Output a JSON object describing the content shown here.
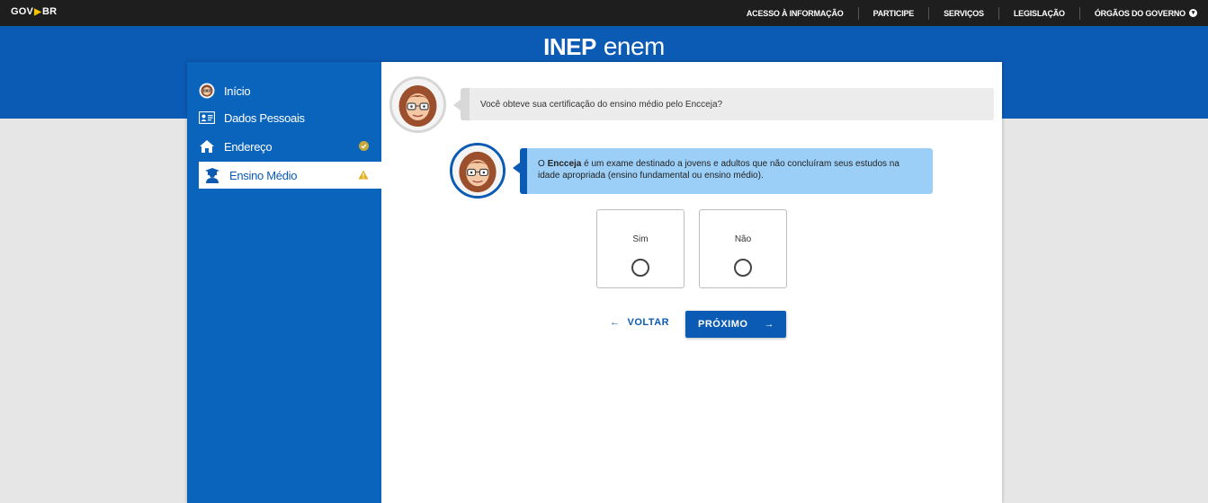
{
  "govbar": {
    "logo_gov": "GOV",
    "logo_br": "BR",
    "nav": [
      "ACESSO À INFORMAÇÃO",
      "PARTICIPE",
      "SERVIÇOS",
      "LEGISLAÇÃO",
      "ÓRGÃOS DO GOVERNO"
    ]
  },
  "brand": {
    "inep": "INEP",
    "enem": "enem"
  },
  "sidebar": {
    "items": [
      {
        "label": "Início",
        "icon": "avatar-icon"
      },
      {
        "label": "Dados Pessoais",
        "icon": "id-card-icon"
      },
      {
        "label": "Endereço",
        "icon": "home-icon",
        "status": "check-icon"
      },
      {
        "label": "Ensino Médio",
        "icon": "graduate-icon",
        "status": "warning-icon",
        "active": true
      }
    ]
  },
  "chat": {
    "question": "Você obteve sua certificação do ensino médio pelo Encceja?",
    "info_bold": "Encceja",
    "info_prefix": "O",
    "info_rest": "é um exame destinado a jovens e adultos que não concluíram seus estudos na idade apropriada (ensino fundamental ou ensino médio)."
  },
  "options": [
    {
      "label": "Sim"
    },
    {
      "label": "Não"
    }
  ],
  "buttons": {
    "back": "VOLTAR",
    "next": "PRÓXIMO"
  },
  "colors": {
    "primary": "#0b5bb5",
    "sidebar": "#0b64bc",
    "info_bubble": "#9ccff7",
    "warning": "#e0b21f",
    "check": "#c9a83a"
  }
}
